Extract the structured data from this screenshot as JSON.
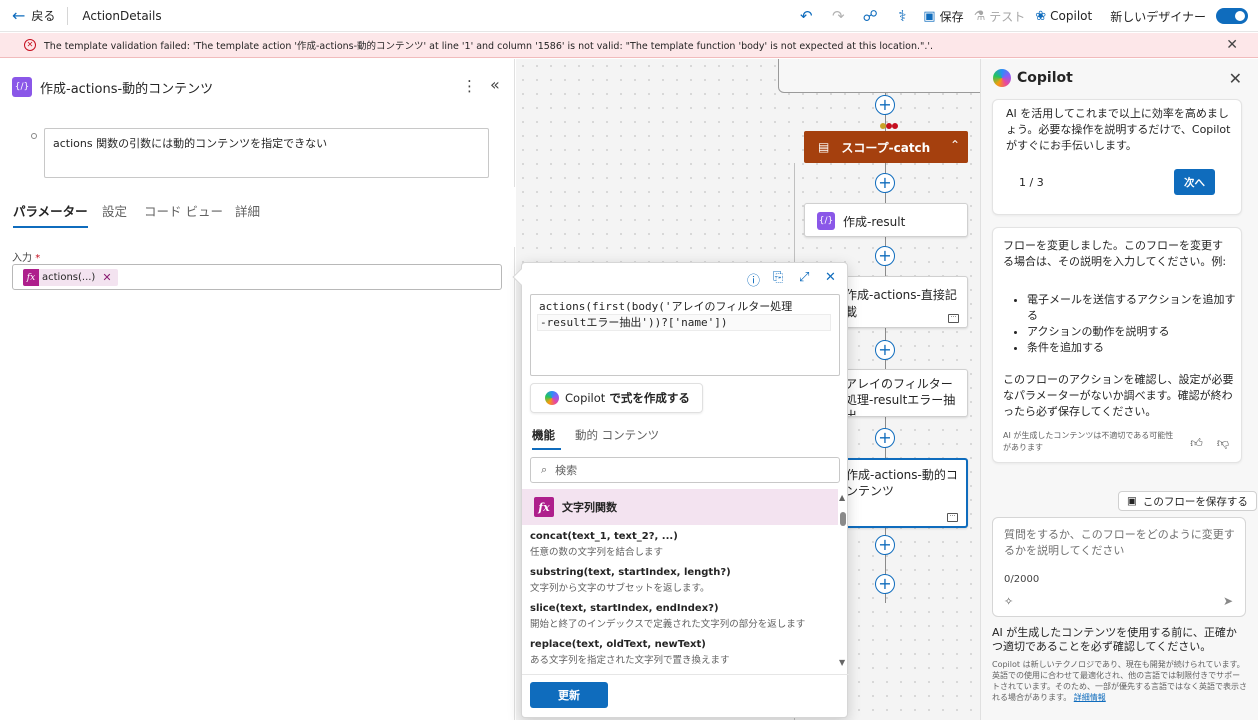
{
  "topbar": {
    "back_label": "戻る",
    "flow_title": "ActionDetails",
    "save_label": "保存",
    "test_label": "テスト",
    "copilot_label": "Copilot",
    "designer_label": "新しいデザイナー",
    "designer_toggle_on": true
  },
  "error_banner": {
    "message": "The template validation failed: 'The template action '作成-actions-動的コンテンツ' at line '1' and column '1586' is not valid: \"The template function 'body' is not expected at this location.\".'."
  },
  "left_panel": {
    "action_title": "作成-actions-動的コンテンツ",
    "note_text": "actions 関数の引数には動的コンテンツを指定できない",
    "tabs": [
      "パラメーター",
      "設定",
      "コード ビュー",
      "詳細"
    ],
    "active_tab": "パラメーター",
    "input_label": "入力",
    "input_required_mark": "*",
    "token_label": "actions(...)"
  },
  "canvas": {
    "scope_label": "スコープ-catch",
    "nodes": [
      {
        "label": "作成-result"
      },
      {
        "label": "作成-actions-直接記載"
      },
      {
        "label": "アレイのフィルター処理-resultエラー抽出"
      },
      {
        "label": "作成-actions-動的コンテンツ"
      }
    ],
    "colors": {
      "scope": "#a5400e",
      "accent": "#0f6cbd"
    }
  },
  "expression_editor": {
    "expression_line1": "actions(first(body('アレイのフィルター処理",
    "expression_line2": "-resultエラー抽出'))?['name'])",
    "copilot_button_prefix": "Copilot",
    "copilot_button_suffix": " で式を作成する",
    "tabs": [
      "機能",
      "動的 コンテンツ"
    ],
    "active_tab": "機能",
    "search_placeholder": "検索",
    "category_label": "文字列関数",
    "functions": [
      {
        "signature": "concat(text_1, text_2?, ...)",
        "description": "任意の数の文字列を結合します"
      },
      {
        "signature": "substring(text, startIndex, length?)",
        "description": "文字列から文字のサブセットを返します。"
      },
      {
        "signature": "slice(text, startIndex, endIndex?)",
        "description": "開始と終了のインデックスで定義された文字列の部分を返します"
      },
      {
        "signature": "replace(text, oldText, newText)",
        "description": "ある文字列を指定された文字列で置き換えます"
      }
    ],
    "update_label": "更新"
  },
  "copilot_panel": {
    "title": "Copilot",
    "card1_text": "AI を活用してこれまで以上に効率を高めましょう。必要な操作を説明するだけで、Copilot がすぐにお手伝いします。",
    "card1_page": "1 / 3",
    "card1_next": "次へ",
    "card2_intro": "フローを変更しました。このフローを変更する場合は、その説明を入力してください。例:",
    "card2_bullets": [
      "電子メールを送信するアクションを追加する",
      "アクションの動作を説明する",
      "条件を追加する"
    ],
    "card2_check": "このフローのアクションを確認し、設定が必要なパラメーターがないか調べます。確認が終わったら必ず保存してください。",
    "card2_disclaimer": "AI が生成したコンテンツは不適切である可能性があります",
    "save_flow_label": "このフローを保存する",
    "input_placeholder": "質問をするか、このフローをどのように変更するかを説明してください",
    "char_count": "0/2000",
    "ai_note": "AI が生成したコンテンツを使用する前に、正確かつ適切であることを必ず確認してください。",
    "fine_print": "Copilot は新しいテクノロジであり、現在も開発が続けられています。英語での使用に合わせて最適化され、他の言語では制限付きでサポートされています。そのため、一部が優先する言語ではなく英語で表示される場合があります。",
    "fine_print_link": "詳細情報"
  }
}
